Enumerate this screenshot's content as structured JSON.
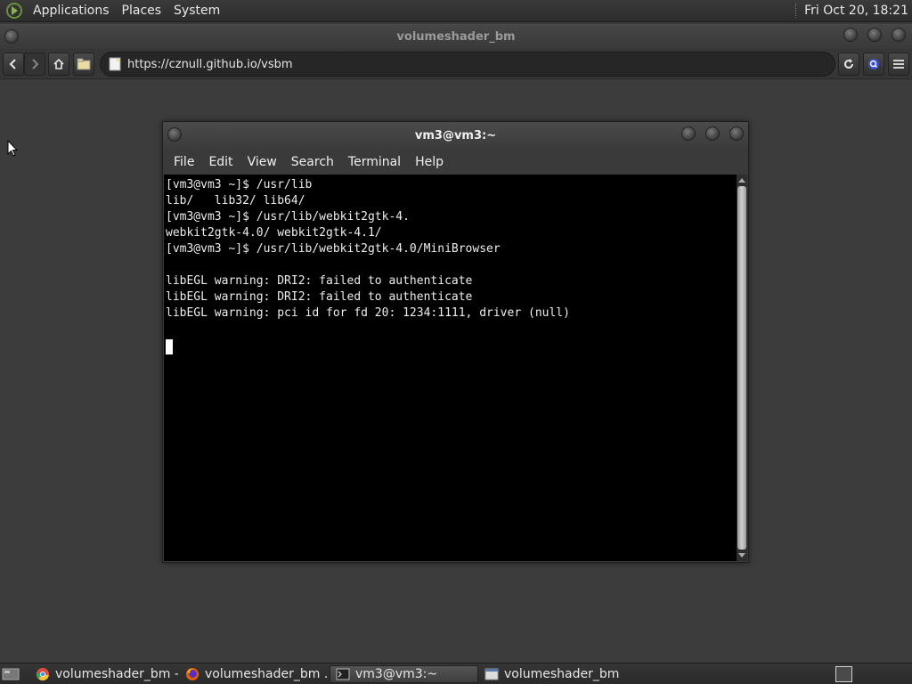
{
  "top_panel": {
    "menus": [
      "Applications",
      "Places",
      "System"
    ],
    "clock": "Fri Oct 20, 18:21"
  },
  "browser": {
    "title": "volumeshader_bm",
    "url": "https://cznull.github.io/vsbm"
  },
  "terminal": {
    "title": "vm3@vm3:~",
    "menu": [
      "File",
      "Edit",
      "View",
      "Search",
      "Terminal",
      "Help"
    ],
    "lines": [
      "[vm3@vm3 ~]$ /usr/lib",
      "lib/   lib32/ lib64/",
      "[vm3@vm3 ~]$ /usr/lib/webkit2gtk-4.",
      "webkit2gtk-4.0/ webkit2gtk-4.1/",
      "[vm3@vm3 ~]$ /usr/lib/webkit2gtk-4.0/MiniBrowser",
      "",
      "libEGL warning: DRI2: failed to authenticate",
      "libEGL warning: DRI2: failed to authenticate",
      "libEGL warning: pci id for fd 20: 1234:1111, driver (null)",
      ""
    ]
  },
  "taskbar": {
    "tasks": [
      {
        "label": "volumeshader_bm -...",
        "icon": "chrome-icon"
      },
      {
        "label": "volumeshader_bm ...",
        "icon": "firefox-icon"
      },
      {
        "label": "vm3@vm3:~",
        "icon": "terminal-icon"
      },
      {
        "label": "volumeshader_bm",
        "icon": "window-icon"
      }
    ]
  }
}
